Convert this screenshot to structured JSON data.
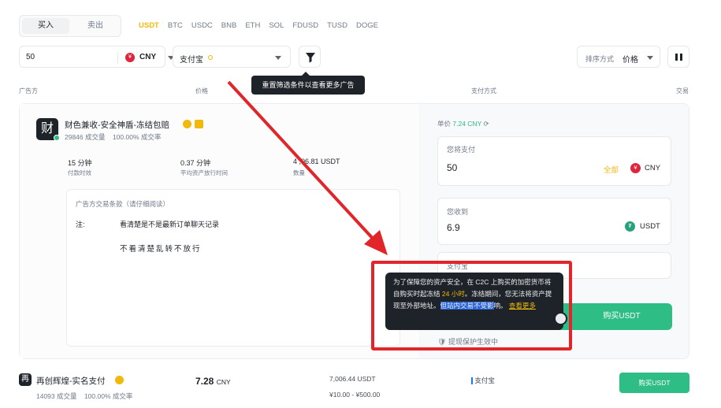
{
  "trade_tabs": {
    "buy": "买入",
    "sell": "卖出"
  },
  "coins": [
    "USDT",
    "BTC",
    "USDC",
    "BNB",
    "ETH",
    "SOL",
    "FDUSD",
    "TUSD",
    "DOGE"
  ],
  "filters": {
    "amount": "50",
    "currency": "CNY",
    "payment": "支付宝",
    "filter_tooltip": "重置筛选条件以查看更多广告",
    "sort_label": "排序方式",
    "sort_value": "价格"
  },
  "table_headers": {
    "advertiser": "广告方",
    "price": "价格",
    "payment": "支付方式",
    "trade": "交易"
  },
  "ad": {
    "merchant_name": "财色兼收-安全神盾-冻结包赔",
    "avatar_char": "财",
    "orders": "29846 成交量",
    "completion": "100.00% 成交率",
    "metrics": [
      {
        "value": "15 分钟",
        "label": "付款时效"
      },
      {
        "value": "0.37 分钟",
        "label": "平均资产放行时间"
      },
      {
        "value": "4 ,06.81 USDT",
        "label": "数量"
      }
    ],
    "terms_title": "广告方交易条款（请仔细阅读）",
    "terms_label": "注:",
    "terms_line1": "看清楚是不是最新订单聊天记录",
    "terms_line2": "不看清楚乱转不放行"
  },
  "order_panel": {
    "unit_price_label": "单价",
    "unit_price": "7.24 CNY",
    "pay_label": "您将支付",
    "pay_value": "50",
    "pay_all": "全部",
    "pay_currency": "CNY",
    "receive_label": "您收到",
    "receive_value": "6.9",
    "receive_currency": "USDT",
    "method_hint": "支付宝",
    "buy_button": "购买USDT",
    "protection": "提现保护生效中"
  },
  "protection_tooltip": {
    "part1": "为了保障您的资产安全，在 C2C 上购买的加密货币将自购买时起冻结 ",
    "highlight": "24 小时",
    "part2": "。冻结期间，您无法将资产提现至外部地址。",
    "selected": "但站内交易不受影",
    "part3": "响。",
    "link": "查看更多"
  },
  "second_ad": {
    "avatar_char": "再",
    "merchant_name": "再创辉煌-实名支付",
    "orders": "14093 成交量",
    "completion": "100.00% 成交率",
    "price": "7.28",
    "price_currency": "CNY",
    "available": "7,006.44 USDT",
    "limit": "¥10.00 - ¥500.00",
    "payment": "支付宝",
    "buy_button": "购买USDT"
  },
  "colors": {
    "brand": "#f0b90b",
    "buy_green": "#2ebd85",
    "annotation_red": "#e0262b"
  }
}
